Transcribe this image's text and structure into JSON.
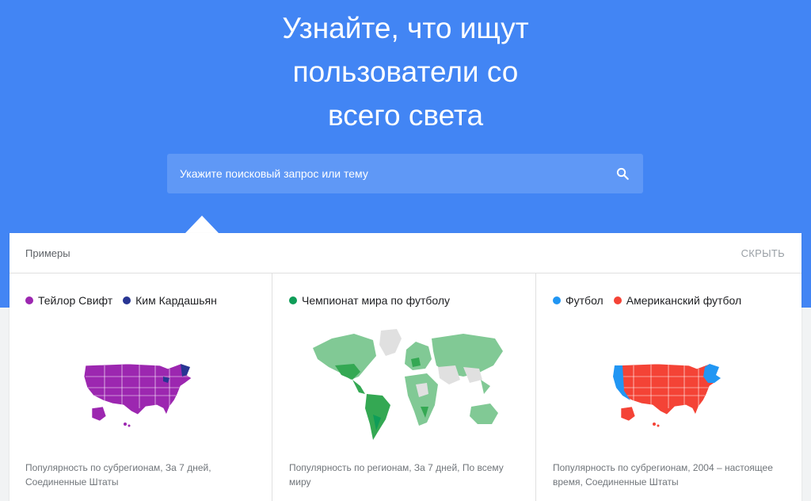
{
  "hero": {
    "title": "Узнайте, что ищут\nпользователи со\nвсего света"
  },
  "search": {
    "placeholder": "Укажите поисковый запрос или тему",
    "icon": "search-icon"
  },
  "examples_panel": {
    "label": "Примеры",
    "hide_label": "СКРЫТЬ"
  },
  "examples": [
    {
      "legend": [
        {
          "label": "Тейлор Свифт",
          "color": "#9c27b0"
        },
        {
          "label": "Ким Кардашьян",
          "color": "#283593"
        }
      ],
      "map": "us-map",
      "caption": "Популярность по субрегионам, За 7 дней, Соединенные Штаты"
    },
    {
      "legend": [
        {
          "label": "Чемпионат мира по футболу",
          "color": "#0f9d58"
        }
      ],
      "map": "world-map",
      "caption": "Популярность по регионам, За 7 дней, По всему миру"
    },
    {
      "legend": [
        {
          "label": "Футбол",
          "color": "#2196f3"
        },
        {
          "label": "Американский футбол",
          "color": "#f44336"
        }
      ],
      "map": "us-map",
      "caption": "Популярность по субрегионам, 2004 – настоящее время, Соединенные Штаты"
    }
  ]
}
